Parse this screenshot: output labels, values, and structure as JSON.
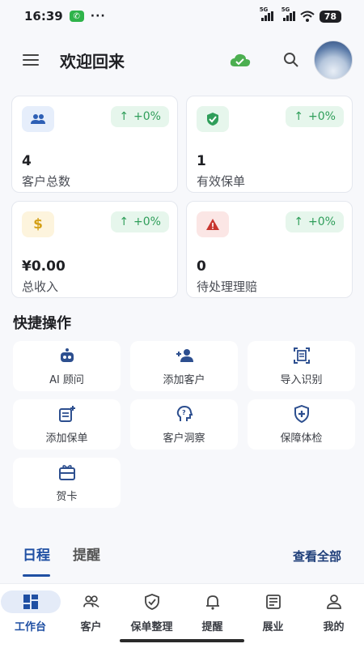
{
  "status": {
    "time": "16:39",
    "dots": "···",
    "net1": "5G",
    "net2": "5G",
    "battery": "78"
  },
  "header": {
    "title": "欢迎回来",
    "icons": [
      "menu-icon",
      "cloud-check-icon",
      "search-icon",
      "avatar"
    ]
  },
  "stats": [
    {
      "value": "4",
      "label": "客户总数",
      "trend": "+0%",
      "icon": "people-icon",
      "color": "#2d5fb5",
      "bg": "#e6eefb"
    },
    {
      "value": "1",
      "label": "有效保单",
      "trend": "+0%",
      "icon": "shield-check-icon",
      "color": "#2f9e5a",
      "bg": "#e6f6ec"
    },
    {
      "value": "¥0.00",
      "label": "总收入",
      "trend": "+0%",
      "icon": "dollar-icon",
      "color": "#d4a017",
      "bg": "#fdf4dd"
    },
    {
      "value": "0",
      "label": "待处理理赔",
      "trend": "+0%",
      "icon": "warning-icon",
      "color": "#c8352e",
      "bg": "#fbe6e5"
    }
  ],
  "quick_actions": {
    "title": "快捷操作",
    "items": [
      {
        "label": "AI 顾问",
        "icon": "robot-icon"
      },
      {
        "label": "添加客户",
        "icon": "add-person-icon"
      },
      {
        "label": "导入识别",
        "icon": "scan-document-icon"
      },
      {
        "label": "添加保单",
        "icon": "add-policy-icon"
      },
      {
        "label": "客户洞察",
        "icon": "insight-head-icon"
      },
      {
        "label": "保障体检",
        "icon": "shield-plus-icon"
      },
      {
        "label": "贺卡",
        "icon": "gift-card-icon"
      }
    ]
  },
  "tabs": {
    "items": [
      "日程",
      "提醒"
    ],
    "view_all": "查看全部"
  },
  "bottom_nav": [
    {
      "label": "工作台",
      "icon": "dashboard-icon",
      "active": true
    },
    {
      "label": "客户",
      "icon": "customers-icon",
      "active": false
    },
    {
      "label": "保单整理",
      "icon": "policy-shield-icon",
      "active": false
    },
    {
      "label": "提醒",
      "icon": "bell-icon",
      "active": false
    },
    {
      "label": "展业",
      "icon": "newspaper-icon",
      "active": false
    },
    {
      "label": "我的",
      "icon": "profile-icon",
      "active": false
    }
  ],
  "colors": {
    "accent": "#1f4fa3",
    "trend_green": "#2f9e5a"
  }
}
